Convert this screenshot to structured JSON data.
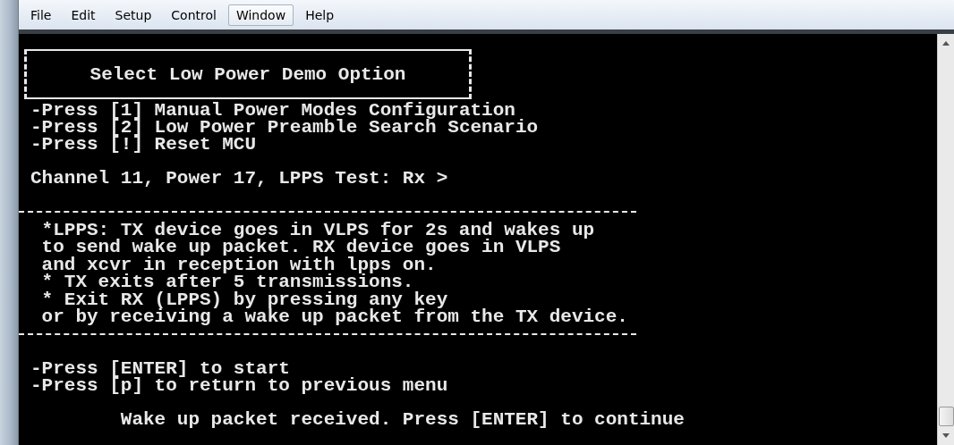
{
  "menu": [
    {
      "label": "File",
      "selected": false
    },
    {
      "label": "Edit",
      "selected": false
    },
    {
      "label": "Setup",
      "selected": false
    },
    {
      "label": "Control",
      "selected": false
    },
    {
      "label": "Window",
      "selected": true
    },
    {
      "label": "Help",
      "selected": false
    }
  ],
  "terminal": {
    "banner": {
      "title": "Select Low Power Demo Option"
    },
    "menu_options": [
      "-Press [1] Manual Power Modes Configuration",
      "-Press [2] Low Power Preamble Search Scenario",
      "-Press [!] Reset MCU"
    ],
    "status_line": "Channel 11, Power 17, LPPS Test: Rx >",
    "info_box": {
      "lines": [
        "*LPPS: TX device goes in VLPS for 2s and wakes up",
        "to send wake up packet. RX device goes in VLPS",
        "and xcvr in reception with lpps on.",
        "* TX exits after 5 transmissions.",
        "* Exit RX (LPPS) by pressing any key",
        "or by receiving a wake up packet from the TX device."
      ]
    },
    "prompts": [
      "-Press [ENTER] to start",
      "-Press [p] to return to previous menu"
    ],
    "message": "Wake up packet received. Press [ENTER] to continue"
  }
}
